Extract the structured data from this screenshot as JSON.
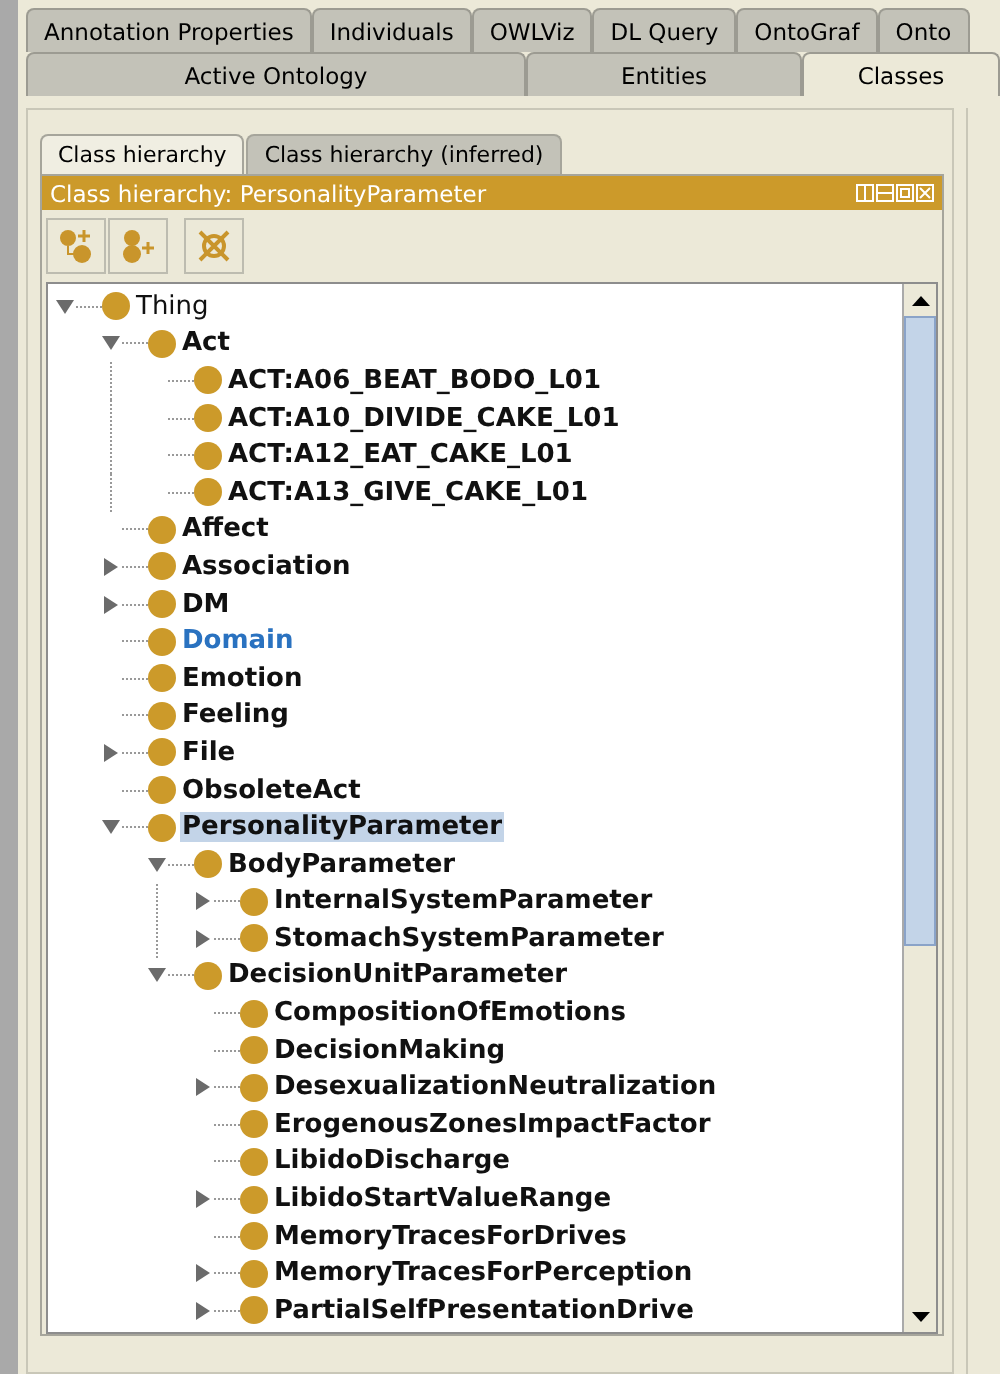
{
  "top_tabs": [
    {
      "label": "Annotation Properties",
      "selected": false
    },
    {
      "label": "Individuals",
      "selected": false
    },
    {
      "label": "OWLViz",
      "selected": false
    },
    {
      "label": "DL Query",
      "selected": false
    },
    {
      "label": "OntoGraf",
      "selected": false
    },
    {
      "label": "Onto",
      "selected": false
    }
  ],
  "main_tabs": [
    {
      "label": "Active Ontology",
      "selected": false
    },
    {
      "label": "Entities",
      "selected": false
    },
    {
      "label": "Classes",
      "selected": true
    }
  ],
  "view_tabs": [
    {
      "label": "Class hierarchy",
      "selected": true
    },
    {
      "label": "Class hierarchy (inferred)",
      "selected": false
    }
  ],
  "view_title": "Class hierarchy: PersonalityParameter",
  "tree": [
    {
      "label": "Thing",
      "kind": "root",
      "expanded": true,
      "selected": false,
      "children": [
        {
          "label": "Act",
          "kind": "class",
          "expanded": true,
          "selected": false,
          "children": [
            {
              "label": "ACT:A06_BEAT_BODO_L01",
              "kind": "class",
              "selected": false
            },
            {
              "label": "ACT:A10_DIVIDE_CAKE_L01",
              "kind": "class",
              "selected": false
            },
            {
              "label": "ACT:A12_EAT_CAKE_L01",
              "kind": "class",
              "selected": false
            },
            {
              "label": "ACT:A13_GIVE_CAKE_L01",
              "kind": "class",
              "selected": false
            }
          ]
        },
        {
          "label": "Affect",
          "kind": "class",
          "selected": false
        },
        {
          "label": "Association",
          "kind": "class",
          "expanded": false,
          "selected": false
        },
        {
          "label": "DM",
          "kind": "class",
          "expanded": false,
          "selected": false
        },
        {
          "label": "Domain",
          "kind": "linked",
          "selected": false
        },
        {
          "label": "Emotion",
          "kind": "class",
          "selected": false
        },
        {
          "label": "Feeling",
          "kind": "class",
          "selected": false
        },
        {
          "label": "File",
          "kind": "class",
          "expanded": false,
          "selected": false
        },
        {
          "label": "ObsoleteAct",
          "kind": "class",
          "selected": false
        },
        {
          "label": "PersonalityParameter",
          "kind": "class",
          "expanded": true,
          "selected": true,
          "children": [
            {
              "label": "BodyParameter",
              "kind": "class",
              "expanded": true,
              "selected": false,
              "children": [
                {
                  "label": "InternalSystemParameter",
                  "kind": "class",
                  "expanded": false,
                  "selected": false
                },
                {
                  "label": "StomachSystemParameter",
                  "kind": "class",
                  "expanded": false,
                  "selected": false
                }
              ]
            },
            {
              "label": "DecisionUnitParameter",
              "kind": "class",
              "expanded": true,
              "selected": false,
              "children": [
                {
                  "label": "CompositionOfEmotions",
                  "kind": "class",
                  "selected": false
                },
                {
                  "label": "DecisionMaking",
                  "kind": "class",
                  "selected": false
                },
                {
                  "label": "DesexualizationNeutralization",
                  "kind": "class",
                  "expanded": false,
                  "selected": false
                },
                {
                  "label": "ErogenousZonesImpactFactor",
                  "kind": "class",
                  "selected": false
                },
                {
                  "label": "LibidoDischarge",
                  "kind": "class",
                  "selected": false
                },
                {
                  "label": "LibidoStartValueRange",
                  "kind": "class",
                  "expanded": false,
                  "selected": false
                },
                {
                  "label": "MemoryTracesForDrives",
                  "kind": "class",
                  "selected": false
                },
                {
                  "label": "MemoryTracesForPerception",
                  "kind": "class",
                  "expanded": false,
                  "selected": false
                },
                {
                  "label": "PartialSelfPresentationDrive",
                  "kind": "class",
                  "expanded": false,
                  "selected": false
                }
              ]
            }
          ]
        }
      ]
    }
  ]
}
